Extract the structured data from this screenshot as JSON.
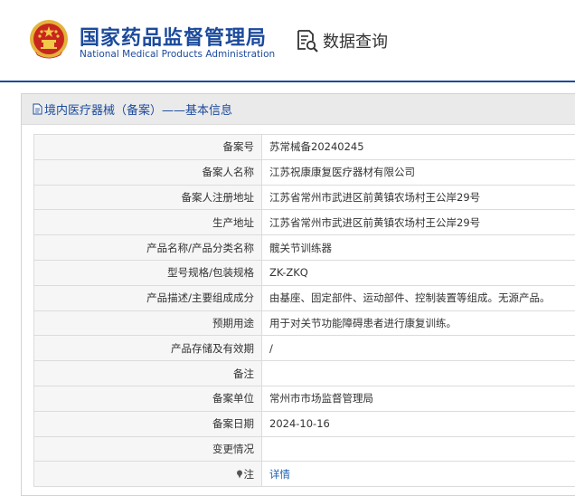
{
  "header": {
    "brand_cn": "国家药品监督管理局",
    "brand_en": "National Medical Products Administration",
    "query_label": "数据查询",
    "accent_color": "#1c4a9c"
  },
  "panel": {
    "title": "境内医疗器械（备案）——基本信息"
  },
  "rows": [
    {
      "label": "备案号",
      "value": "苏常械备20240245"
    },
    {
      "label": "备案人名称",
      "value": "江苏祝康康复医疗器材有限公司"
    },
    {
      "label": "备案人注册地址",
      "value": "江苏省常州市武进区前黄镇农场村王公岸29号"
    },
    {
      "label": "生产地址",
      "value": "江苏省常州市武进区前黄镇农场村王公岸29号"
    },
    {
      "label": "产品名称/产品分类名称",
      "value": "髋关节训练器"
    },
    {
      "label": "型号规格/包装规格",
      "value": "ZK-ZKQ"
    },
    {
      "label": "产品描述/主要组成成分",
      "value": "由基座、固定部件、运动部件、控制装置等组成。无源产品。"
    },
    {
      "label": "预期用途",
      "value": "用于对关节功能障碍患者进行康复训练。"
    },
    {
      "label": "产品存储及有效期",
      "value": "/"
    },
    {
      "label": "备注",
      "value": ""
    },
    {
      "label": "备案单位",
      "value": "常州市市场监督管理局"
    },
    {
      "label": "备案日期",
      "value": "2024-10-16"
    },
    {
      "label": "变更情况",
      "value": ""
    },
    {
      "label": "注",
      "value": "详情"
    }
  ]
}
